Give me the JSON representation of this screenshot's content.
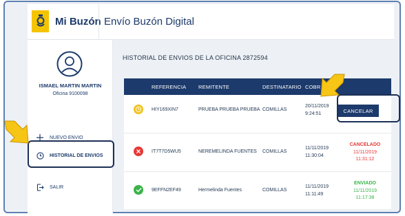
{
  "header": {
    "brand": "Mi Buzón",
    "title": "Envío Buzón Digital"
  },
  "user": {
    "name": "ISMAEL MARTIN MARTIN",
    "office": "Oficina 9100098"
  },
  "sidebar": {
    "items": [
      {
        "label": "NUEVO ENVIO",
        "icon": "plus-icon"
      },
      {
        "label": "HISTORIAL DE ENVIOS",
        "icon": "clock-icon"
      },
      {
        "label": "SALIR",
        "icon": "logout-icon"
      }
    ]
  },
  "main": {
    "title": "HISTORIAL DE ENVIOS DE LA OFICINA 2872594"
  },
  "table": {
    "columns": [
      "REFERENCIA",
      "REMITENTE",
      "DESTINATARIO",
      "COBR"
    ],
    "rows": [
      {
        "status_icon": "pending-clock-icon",
        "referencia": "HIY169XIN7",
        "remitente": "PRUEBA PRUEBA PRUEBA",
        "destinatario": "COMILLAS",
        "date": "20/11/2019",
        "time": "9:24:51",
        "action": "CANCELAR"
      },
      {
        "status_icon": "cancel-x-icon",
        "referencia": "IT7T7D5WU5",
        "remitente": "NEREMELINDA FUENTES",
        "destinatario": "COMILLAS",
        "date": "11/11/2019",
        "time": "11:30:04",
        "status": "CANCELADO",
        "status_date": "11/11/2019",
        "status_time": "11:31:12"
      },
      {
        "status_icon": "check-icon",
        "referencia": "9EFFN2EF49",
        "remitente": "Hermelinda Fuentes",
        "destinatario": "COMILLAS",
        "date": "11/11/2019",
        "time": "11:11:49",
        "status": "ENVIADO",
        "status_date": "11/11/2019",
        "status_time": "11:17:38"
      }
    ]
  },
  "colors": {
    "primary": "#1c3a6b",
    "brand_yellow": "#f5c400",
    "pending": "#f2c21b",
    "cancelled": "#e53935",
    "sent": "#3bb34a",
    "arrow": "#f6c516"
  }
}
